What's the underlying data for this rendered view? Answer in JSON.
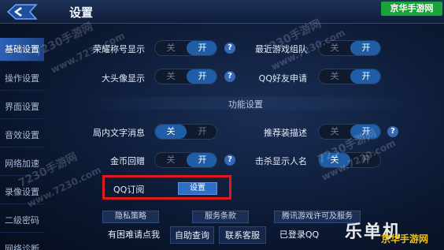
{
  "header": {
    "title": "设置"
  },
  "sidebar": {
    "items": [
      {
        "label": "基础设置",
        "active": true
      },
      {
        "label": "操作设置",
        "active": false
      },
      {
        "label": "界面设置",
        "active": false
      },
      {
        "label": "音效设置",
        "active": false
      },
      {
        "label": "网络加速",
        "active": false
      },
      {
        "label": "录像设置",
        "active": false
      },
      {
        "label": "二级密码",
        "active": false
      },
      {
        "label": "网络诊断",
        "active": false
      }
    ]
  },
  "toggles": {
    "off_label": "关",
    "on_label": "开",
    "rows": [
      {
        "label": "荣耀称号显示",
        "value": "on",
        "help": true
      },
      {
        "label": "最近游戏组队",
        "value": "on",
        "help": false
      },
      {
        "label": "大头像显示",
        "value": "on",
        "help": true
      },
      {
        "label": "QQ好友申请",
        "value": "on",
        "help": false
      },
      {
        "label": "局内文字消息",
        "value": "off",
        "help": false
      },
      {
        "label": "推荐装描述",
        "value": "on",
        "help": true
      },
      {
        "label": "金币回赠",
        "value": "on",
        "help": true
      },
      {
        "label": "击杀显示人名",
        "value": "off",
        "help": false
      }
    ]
  },
  "section": {
    "title": "功能设置"
  },
  "qq": {
    "label": "QQ订阅",
    "button": "设置"
  },
  "bottom_tabs": [
    "隐私策略",
    "服务条款",
    "腾讯游戏许可及服务"
  ],
  "bottom_links": {
    "prompt": "有困难请点我",
    "help": "自助查询",
    "contact": "联系客服",
    "login": "已登录QQ"
  },
  "colors": {
    "accent": "#2f6fc6",
    "highlight": "#e0191d",
    "active_tab": "#2c63b8"
  },
  "watermark": {
    "site": "7230手游网",
    "url": "www.7230.com"
  },
  "logo": {
    "main": "乐单机",
    "sub": "京华手游网",
    "badge": "京华手游网"
  }
}
